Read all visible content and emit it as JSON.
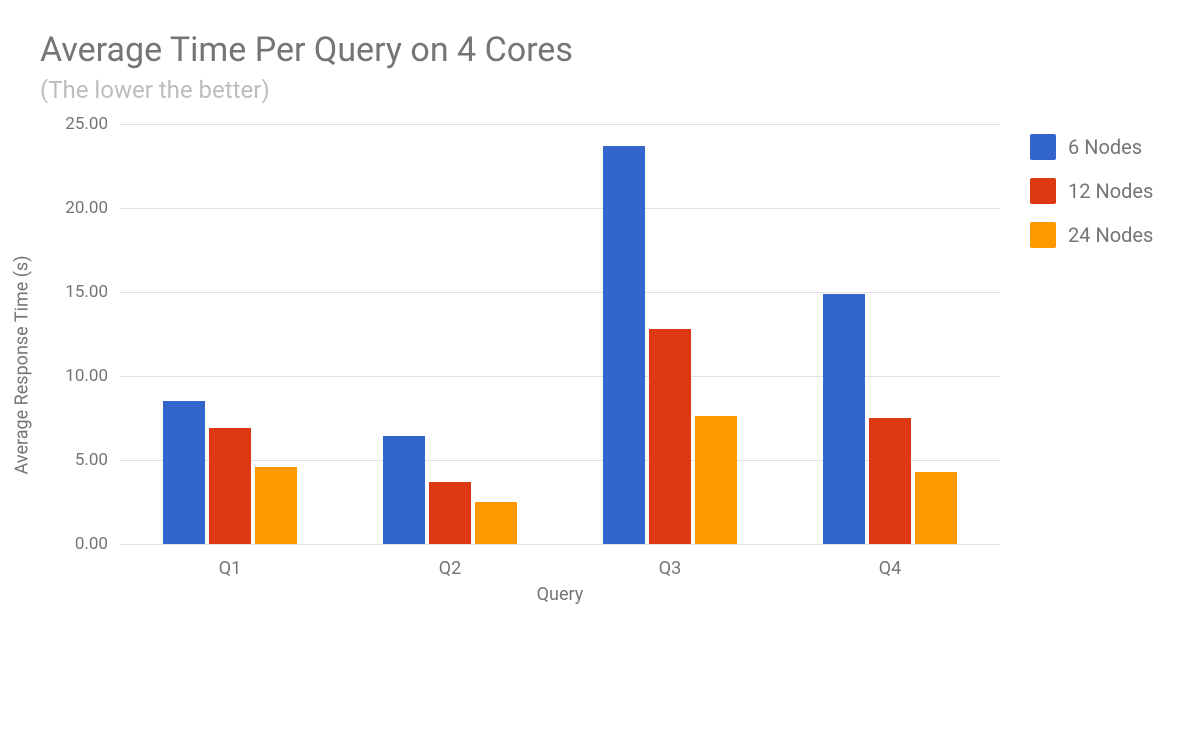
{
  "chart_data": {
    "type": "bar",
    "title": "Average Time Per Query on 4 Cores",
    "subtitle": "(The lower the better)",
    "xlabel": "Query",
    "ylabel": "Average Response Time (s)",
    "categories": [
      "Q1",
      "Q2",
      "Q3",
      "Q4"
    ],
    "series": [
      {
        "name": "6 Nodes",
        "color": "#3366cc",
        "values": [
          8.5,
          6.4,
          23.7,
          14.9
        ]
      },
      {
        "name": "12 Nodes",
        "color": "#dc3912",
        "values": [
          6.9,
          3.7,
          12.8,
          7.5
        ]
      },
      {
        "name": "24 Nodes",
        "color": "#ff9900",
        "values": [
          4.6,
          2.5,
          7.6,
          4.3
        ]
      }
    ],
    "ylim": [
      0,
      25
    ],
    "yticks": [
      "0.00",
      "5.00",
      "10.00",
      "15.00",
      "20.00",
      "25.00"
    ],
    "ytick_values": [
      0,
      5,
      10,
      15,
      20,
      25
    ]
  }
}
